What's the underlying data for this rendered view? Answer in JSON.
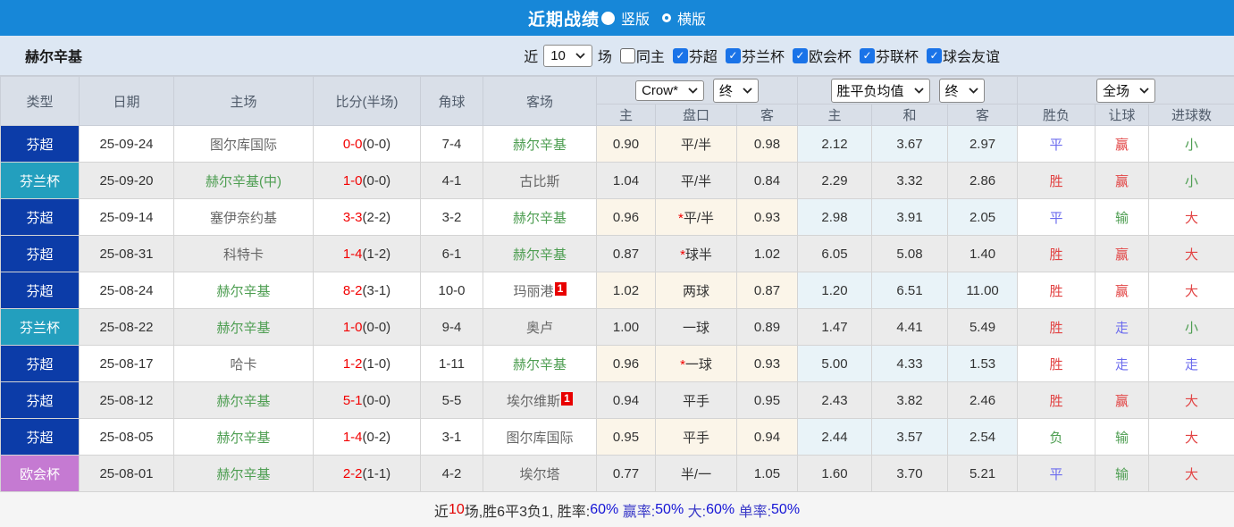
{
  "topbar": {
    "title": "近期战绩",
    "radio_vertical": "竖版",
    "radio_horizontal": "横版",
    "selected": "竖版"
  },
  "filterbar": {
    "team": "赫尔辛基",
    "recent_label": "近",
    "recent_value": "10",
    "matches_label": "场",
    "checkboxes": [
      {
        "label": "同主",
        "checked": false
      },
      {
        "label": "芬超",
        "checked": true
      },
      {
        "label": "芬兰杯",
        "checked": true
      },
      {
        "label": "欧会杯",
        "checked": true
      },
      {
        "label": "芬联杯",
        "checked": true
      },
      {
        "label": "球会友谊",
        "checked": true
      }
    ]
  },
  "table": {
    "headers": {
      "type": "类型",
      "date": "日期",
      "home": "主场",
      "score": "比分(半场)",
      "corner": "角球",
      "away": "客场",
      "ah_home": "主",
      "ah_line": "盘口",
      "ah_away": "客",
      "eu_home": "主",
      "eu_draw": "和",
      "eu_away": "客",
      "wdl": "胜负",
      "handicap": "让球",
      "goals": "进球数"
    },
    "dropdowns": {
      "bookmaker": "Crow*",
      "ah_time": "终",
      "eu_metric": "胜平负均值",
      "eu_time": "终",
      "scope": "全场"
    },
    "league_colors": {
      "芬超": "#0c3ca8",
      "芬兰杯": "#239fbe",
      "欧会杯": "#c57ad2"
    },
    "rows": [
      {
        "league": "芬超",
        "date": "25-09-24",
        "home": {
          "name": "图尔库国际",
          "hl": false,
          "badge": ""
        },
        "score": "0-0",
        "half": "(0-0)",
        "corner": "7-4",
        "away": {
          "name": "赫尔辛基",
          "hl": true,
          "badge": ""
        },
        "ah_star": false,
        "ah_home": "0.90",
        "ah_line": "平/半",
        "ah_away": "0.98",
        "eu_home": "2.12",
        "eu_draw": "3.67",
        "eu_away": "2.97",
        "wdl": {
          "t": "平",
          "c": "blue"
        },
        "hcp": {
          "t": "赢",
          "c": "red"
        },
        "goals": {
          "t": "小",
          "c": "green"
        }
      },
      {
        "league": "芬兰杯",
        "date": "25-09-20",
        "home": {
          "name": "赫尔辛基(中)",
          "hl": true,
          "badge": ""
        },
        "score": "1-0",
        "half": "(0-0)",
        "corner": "4-1",
        "away": {
          "name": "古比斯",
          "hl": false,
          "badge": ""
        },
        "ah_star": false,
        "ah_home": "1.04",
        "ah_line": "平/半",
        "ah_away": "0.84",
        "eu_home": "2.29",
        "eu_draw": "3.32",
        "eu_away": "2.86",
        "wdl": {
          "t": "胜",
          "c": "red"
        },
        "hcp": {
          "t": "赢",
          "c": "red"
        },
        "goals": {
          "t": "小",
          "c": "green"
        }
      },
      {
        "league": "芬超",
        "date": "25-09-14",
        "home": {
          "name": "塞伊奈约基",
          "hl": false,
          "badge": ""
        },
        "score": "3-3",
        "half": "(2-2)",
        "corner": "3-2",
        "away": {
          "name": "赫尔辛基",
          "hl": true,
          "badge": ""
        },
        "ah_star": true,
        "ah_home": "0.96",
        "ah_line": "平/半",
        "ah_away": "0.93",
        "eu_home": "2.98",
        "eu_draw": "3.91",
        "eu_away": "2.05",
        "wdl": {
          "t": "平",
          "c": "blue"
        },
        "hcp": {
          "t": "输",
          "c": "green"
        },
        "goals": {
          "t": "大",
          "c": "red"
        }
      },
      {
        "league": "芬超",
        "date": "25-08-31",
        "home": {
          "name": "科特卡",
          "hl": false,
          "badge": ""
        },
        "score": "1-4",
        "half": "(1-2)",
        "corner": "6-1",
        "away": {
          "name": "赫尔辛基",
          "hl": true,
          "badge": ""
        },
        "ah_star": true,
        "ah_home": "0.87",
        "ah_line": "球半",
        "ah_away": "1.02",
        "eu_home": "6.05",
        "eu_draw": "5.08",
        "eu_away": "1.40",
        "wdl": {
          "t": "胜",
          "c": "red"
        },
        "hcp": {
          "t": "赢",
          "c": "red"
        },
        "goals": {
          "t": "大",
          "c": "red"
        }
      },
      {
        "league": "芬超",
        "date": "25-08-24",
        "home": {
          "name": "赫尔辛基",
          "hl": true,
          "badge": ""
        },
        "score": "8-2",
        "half": "(3-1)",
        "corner": "10-0",
        "away": {
          "name": "玛丽港",
          "hl": false,
          "badge": "1"
        },
        "ah_star": false,
        "ah_home": "1.02",
        "ah_line": "两球",
        "ah_away": "0.87",
        "eu_home": "1.20",
        "eu_draw": "6.51",
        "eu_away": "11.00",
        "wdl": {
          "t": "胜",
          "c": "red"
        },
        "hcp": {
          "t": "赢",
          "c": "red"
        },
        "goals": {
          "t": "大",
          "c": "red"
        }
      },
      {
        "league": "芬兰杯",
        "date": "25-08-22",
        "home": {
          "name": "赫尔辛基",
          "hl": true,
          "badge": ""
        },
        "score": "1-0",
        "half": "(0-0)",
        "corner": "9-4",
        "away": {
          "name": "奥卢",
          "hl": false,
          "badge": ""
        },
        "ah_star": false,
        "ah_home": "1.00",
        "ah_line": "一球",
        "ah_away": "0.89",
        "eu_home": "1.47",
        "eu_draw": "4.41",
        "eu_away": "5.49",
        "wdl": {
          "t": "胜",
          "c": "red"
        },
        "hcp": {
          "t": "走",
          "c": "blue"
        },
        "goals": {
          "t": "小",
          "c": "green"
        }
      },
      {
        "league": "芬超",
        "date": "25-08-17",
        "home": {
          "name": "哈卡",
          "hl": false,
          "badge": ""
        },
        "score": "1-2",
        "half": "(1-0)",
        "corner": "1-11",
        "away": {
          "name": "赫尔辛基",
          "hl": true,
          "badge": ""
        },
        "ah_star": true,
        "ah_home": "0.96",
        "ah_line": "一球",
        "ah_away": "0.93",
        "eu_home": "5.00",
        "eu_draw": "4.33",
        "eu_away": "1.53",
        "wdl": {
          "t": "胜",
          "c": "red"
        },
        "hcp": {
          "t": "走",
          "c": "blue"
        },
        "goals": {
          "t": "走",
          "c": "blue"
        }
      },
      {
        "league": "芬超",
        "date": "25-08-12",
        "home": {
          "name": "赫尔辛基",
          "hl": true,
          "badge": ""
        },
        "score": "5-1",
        "half": "(0-0)",
        "corner": "5-5",
        "away": {
          "name": "埃尔维斯",
          "hl": false,
          "badge": "1"
        },
        "ah_star": false,
        "ah_home": "0.94",
        "ah_line": "平手",
        "ah_away": "0.95",
        "eu_home": "2.43",
        "eu_draw": "3.82",
        "eu_away": "2.46",
        "wdl": {
          "t": "胜",
          "c": "red"
        },
        "hcp": {
          "t": "赢",
          "c": "red"
        },
        "goals": {
          "t": "大",
          "c": "red"
        }
      },
      {
        "league": "芬超",
        "date": "25-08-05",
        "home": {
          "name": "赫尔辛基",
          "hl": true,
          "badge": ""
        },
        "score": "1-4",
        "half": "(0-2)",
        "corner": "3-1",
        "away": {
          "name": "图尔库国际",
          "hl": false,
          "badge": ""
        },
        "ah_star": false,
        "ah_home": "0.95",
        "ah_line": "平手",
        "ah_away": "0.94",
        "eu_home": "2.44",
        "eu_draw": "3.57",
        "eu_away": "2.54",
        "wdl": {
          "t": "负",
          "c": "green"
        },
        "hcp": {
          "t": "输",
          "c": "green"
        },
        "goals": {
          "t": "大",
          "c": "red"
        }
      },
      {
        "league": "欧会杯",
        "date": "25-08-01",
        "home": {
          "name": "赫尔辛基",
          "hl": true,
          "badge": ""
        },
        "score": "2-2",
        "half": "(1-1)",
        "corner": "4-2",
        "away": {
          "name": "埃尔塔",
          "hl": false,
          "badge": ""
        },
        "ah_star": false,
        "ah_home": "0.77",
        "ah_line": "半/一",
        "ah_away": "1.05",
        "eu_home": "1.60",
        "eu_draw": "3.70",
        "eu_away": "5.21",
        "wdl": {
          "t": "平",
          "c": "blue"
        },
        "hcp": {
          "t": "输",
          "c": "green"
        },
        "goals": {
          "t": "大",
          "c": "red"
        }
      }
    ]
  },
  "summary": {
    "parts": [
      {
        "text": "近",
        "color": "dark"
      },
      {
        "text": "10",
        "color": "red"
      },
      {
        "text": "场,胜6平3负1, 胜率:",
        "color": "dark"
      },
      {
        "text": "60%",
        "color": "blue"
      },
      {
        "text": " 赢率:",
        "color": "navy"
      },
      {
        "text": "50%",
        "color": "blue"
      },
      {
        "text": " 大:",
        "color": "navy"
      },
      {
        "text": "60%",
        "color": "blue"
      },
      {
        "text": " 单率:",
        "color": "navy"
      },
      {
        "text": "50%",
        "color": "blue"
      }
    ]
  },
  "colors": {
    "topbar_blue": "#1787d8",
    "filter_bg": "#dde7f3",
    "header_bg": "#d9dfe8",
    "row_alt_gray": "#ebebeb",
    "asian_odds_bg": "#fbf5e9",
    "euro_odds_bg": "#e9f3f8",
    "result_red": "#e24444",
    "result_green": "#4e9e52",
    "result_blue": "#6b6bee",
    "score_red": "#f20000",
    "summary_blue": "#1414d6",
    "checkbox_blue": "#1a73e8",
    "redcard_badge": "#e80000"
  }
}
